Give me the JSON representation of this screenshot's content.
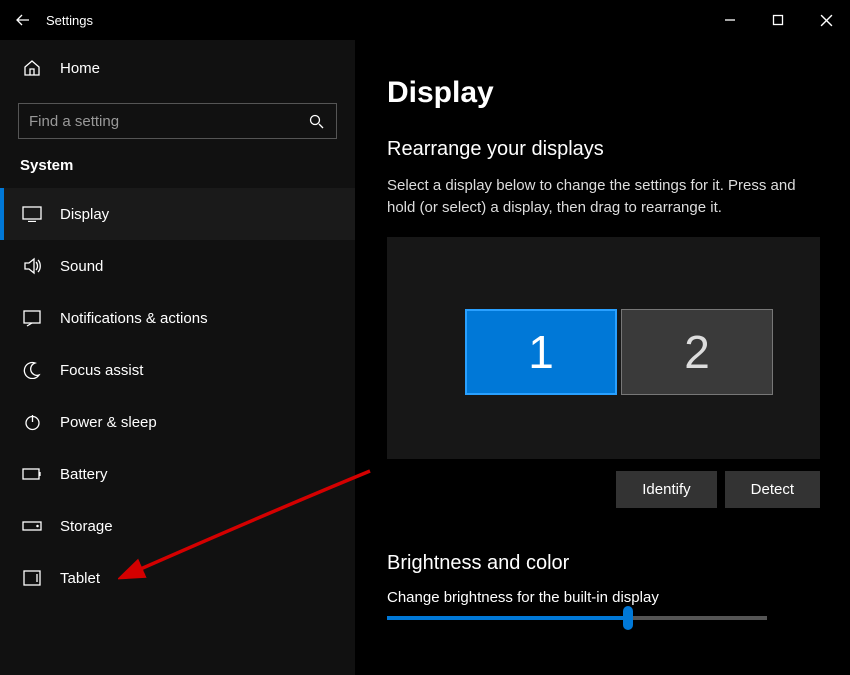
{
  "titlebar": {
    "title": "Settings"
  },
  "sidebar": {
    "home_label": "Home",
    "search_placeholder": "Find a setting",
    "category_label": "System",
    "items": [
      {
        "label": "Display"
      },
      {
        "label": "Sound"
      },
      {
        "label": "Notifications & actions"
      },
      {
        "label": "Focus assist"
      },
      {
        "label": "Power & sleep"
      },
      {
        "label": "Battery"
      },
      {
        "label": "Storage"
      },
      {
        "label": "Tablet"
      }
    ]
  },
  "content": {
    "page_title": "Display",
    "rearrange_title": "Rearrange your displays",
    "rearrange_desc": "Select a display below to change the settings for it. Press and hold (or select) a display, then drag to rearrange it.",
    "monitors": [
      {
        "num": "1"
      },
      {
        "num": "2"
      }
    ],
    "identify_label": "Identify",
    "detect_label": "Detect",
    "brightness_section": "Brightness and color",
    "brightness_label": "Change brightness for the built-in display",
    "brightness_percent": 62
  }
}
